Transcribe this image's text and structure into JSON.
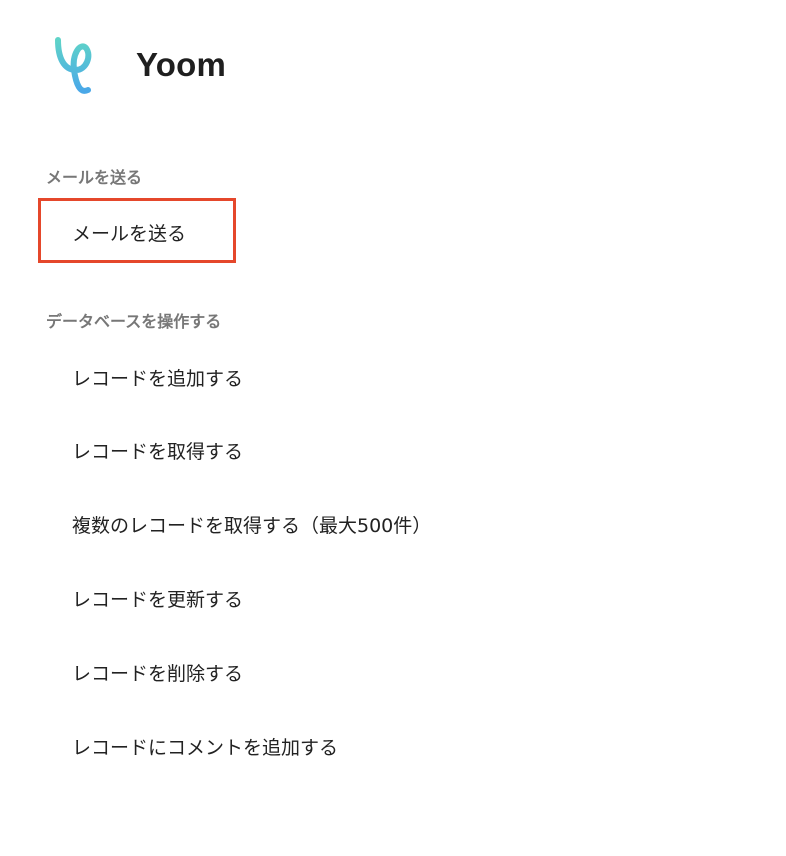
{
  "app": {
    "name": "Yoom",
    "logo_icon": "yoom-logo-icon"
  },
  "colors": {
    "highlight_border": "#e5472b",
    "section_title": "#777777",
    "text": "#222222"
  },
  "sections": [
    {
      "title": "メールを送る",
      "items": [
        "メールを送る"
      ]
    },
    {
      "title": "データベースを操作する",
      "items": [
        "レコードを追加する",
        "レコードを取得する",
        "複数のレコードを取得する（最大500件）",
        "レコードを更新する",
        "レコードを削除する",
        "レコードにコメントを追加する"
      ]
    }
  ]
}
